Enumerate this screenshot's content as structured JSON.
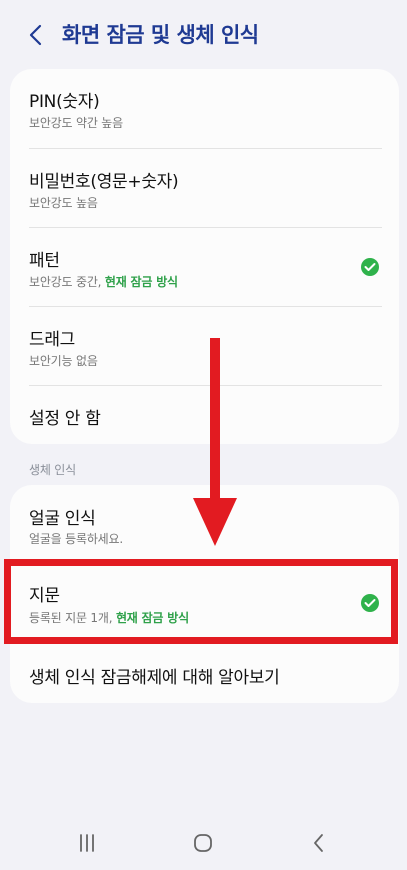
{
  "header": {
    "title": "화면 잠금 및 생체 인식"
  },
  "lock_types": [
    {
      "title": "PIN(숫자)",
      "subtitle": "보안강도 약간 높음"
    },
    {
      "title": "비밀번호(영문+숫자)",
      "subtitle": "보안강도 높음"
    },
    {
      "title": "패턴",
      "subtitle": "보안강도 중간, ",
      "highlight": "현재 잠금 방식",
      "selected": true
    },
    {
      "title": "드래그",
      "subtitle": "보안기능 없음"
    },
    {
      "title": "설정 안 함"
    }
  ],
  "biometrics": {
    "section_label": "생체 인식",
    "items": [
      {
        "title": "얼굴 인식",
        "subtitle": "얼굴을 등록하세요."
      },
      {
        "title": "지문",
        "subtitle": "등록된 지문 1개, ",
        "highlight": "현재 잠금 방식",
        "selected": true
      },
      {
        "title": "생체 인식 잠금해제에 대해 알아보기"
      }
    ]
  },
  "colors": {
    "title": "#1f3a93",
    "check": "#2fb24b",
    "annotation": "#e21b21"
  },
  "icons": {
    "back": "chevron-left-icon",
    "check": "check-circle-icon",
    "nav_recent": "recent-apps-icon",
    "nav_home": "home-icon",
    "nav_back": "back-icon"
  }
}
